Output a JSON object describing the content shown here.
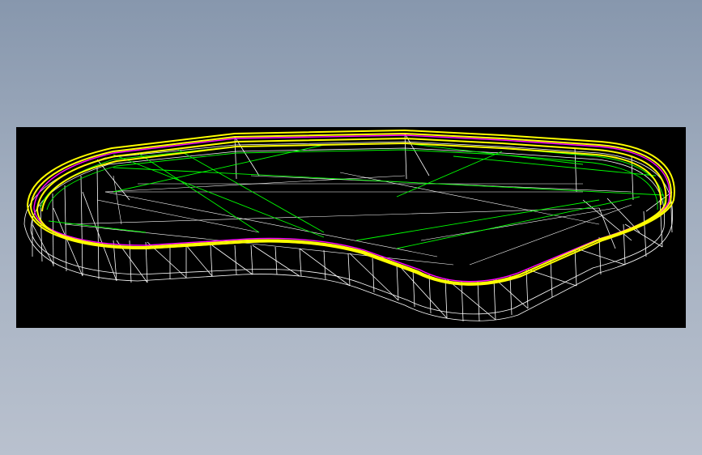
{
  "scene": {
    "description_free": true,
    "viewport_background_top": "#8797ad",
    "viewport_background_bottom": "#b9c1ce",
    "panel_background": "#000000"
  },
  "colors": {
    "outer_rim": "#ffff00",
    "inner_rim": "#ff00ff",
    "edge_green": "#00ff00",
    "mesh_white": "#ffffff"
  },
  "icons": {
    "model": "wireframe-tray-model"
  }
}
